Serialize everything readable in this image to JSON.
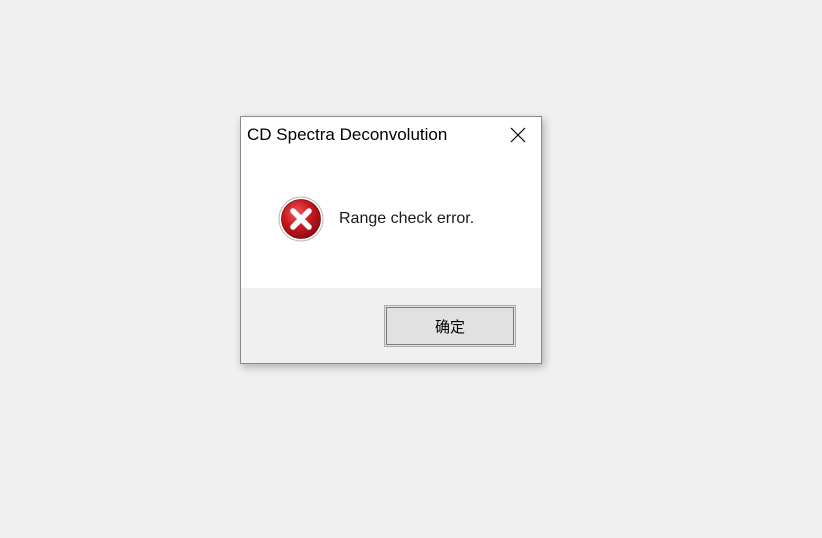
{
  "dialog": {
    "title": "CD Spectra Deconvolution",
    "message": "Range check error.",
    "icon": "error-icon",
    "ok_label": "确定",
    "close_icon": "close-icon"
  },
  "colors": {
    "desktop_bg": "#f0f0f0",
    "content_bg": "#ffffff",
    "footer_bg": "#f0f0f0",
    "error_red": "#c8191f",
    "button_bg": "#e1e1e1"
  }
}
